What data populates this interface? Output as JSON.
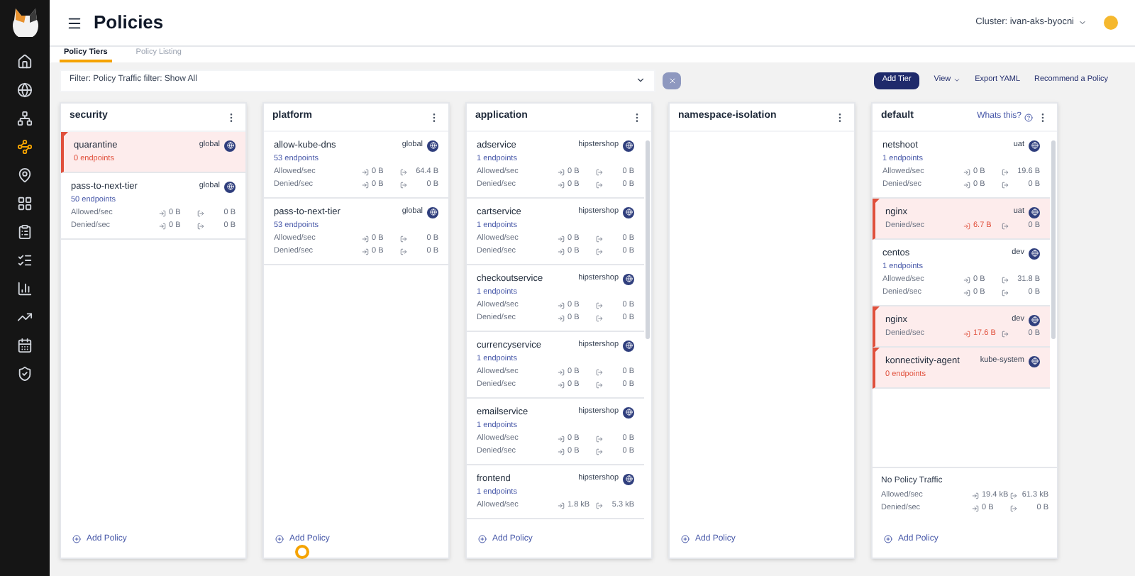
{
  "header": {
    "title": "Policies",
    "cluster": "Cluster: ivan-aks-byocni"
  },
  "sidebar": {
    "items": [
      {
        "selected": false
      },
      {
        "selected": false
      },
      {
        "selected": false
      },
      {
        "selected": true
      },
      {
        "selected": false
      },
      {
        "selected": false
      },
      {
        "selected": false
      },
      {
        "selected": false
      },
      {
        "selected": false
      },
      {
        "selected": false
      },
      {
        "selected": false
      },
      {
        "selected": false
      }
    ]
  },
  "tabs": [
    {
      "label": "Policy Tiers",
      "selected": true
    },
    {
      "label": "Policy Listing",
      "selected": false
    }
  ],
  "filter": {
    "value": "Filter: Policy Traffic filter: Show All"
  },
  "toolbar": [
    {
      "label": "Add Tier",
      "kind": "primary"
    },
    {
      "label": "View",
      "kind": "menu"
    },
    {
      "label": "Export YAML",
      "kind": "link"
    },
    {
      "label": "Recommend a Policy",
      "kind": "link"
    }
  ],
  "tiers": [
    {
      "name": "security",
      "scrollable": false,
      "pointer": false,
      "add_label": "Add Policy",
      "policies": [
        {
          "name": "quarantine",
          "namespace": "global",
          "alert": true,
          "endpoints": "0 endpoints"
        },
        {
          "name": "pass-to-next-tier",
          "namespace": "global",
          "alert": false,
          "endpoints": "50 endpoints",
          "rows": [
            {
              "label": "Allowed/sec",
              "in": "0 B",
              "out": "0 B",
              "alert": false
            },
            {
              "label": "Denied/sec",
              "in": "0 B",
              "out": "0 B",
              "alert": false
            }
          ]
        }
      ]
    },
    {
      "name": "platform",
      "scrollable": false,
      "pointer": true,
      "add_label": "Add Policy",
      "policies": [
        {
          "name": "allow-kube-dns",
          "namespace": "global",
          "alert": false,
          "endpoints": "53 endpoints",
          "rows": [
            {
              "label": "Allowed/sec",
              "in": "0 B",
              "out": "64.4 B",
              "alert": false
            },
            {
              "label": "Denied/sec",
              "in": "0 B",
              "out": "0 B",
              "alert": false
            }
          ]
        },
        {
          "name": "pass-to-next-tier",
          "namespace": "global",
          "alert": false,
          "endpoints": "53 endpoints",
          "rows": [
            {
              "label": "Allowed/sec",
              "in": "0 B",
              "out": "0 B",
              "alert": false
            },
            {
              "label": "Denied/sec",
              "in": "0 B",
              "out": "0 B",
              "alert": false
            }
          ]
        }
      ]
    },
    {
      "name": "application",
      "scrollable": true,
      "pointer": false,
      "add_label": "Add Policy",
      "policies": [
        {
          "name": "adservice",
          "namespace": "hipstershop",
          "alert": false,
          "endpoints": "1 endpoints",
          "rows": [
            {
              "label": "Allowed/sec",
              "in": "0 B",
              "out": "0 B",
              "alert": false
            },
            {
              "label": "Denied/sec",
              "in": "0 B",
              "out": "0 B",
              "alert": false
            }
          ]
        },
        {
          "name": "cartservice",
          "namespace": "hipstershop",
          "alert": false,
          "endpoints": "1 endpoints",
          "rows": [
            {
              "label": "Allowed/sec",
              "in": "0 B",
              "out": "0 B",
              "alert": false
            },
            {
              "label": "Denied/sec",
              "in": "0 B",
              "out": "0 B",
              "alert": false
            }
          ]
        },
        {
          "name": "checkoutservice",
          "namespace": "hipstershop",
          "alert": false,
          "endpoints": "1 endpoints",
          "rows": [
            {
              "label": "Allowed/sec",
              "in": "0 B",
              "out": "0 B",
              "alert": false
            },
            {
              "label": "Denied/sec",
              "in": "0 B",
              "out": "0 B",
              "alert": false
            }
          ]
        },
        {
          "name": "currencyservice",
          "namespace": "hipstershop",
          "alert": false,
          "endpoints": "1 endpoints",
          "rows": [
            {
              "label": "Allowed/sec",
              "in": "0 B",
              "out": "0 B",
              "alert": false
            },
            {
              "label": "Denied/sec",
              "in": "0 B",
              "out": "0 B",
              "alert": false
            }
          ]
        },
        {
          "name": "emailservice",
          "namespace": "hipstershop",
          "alert": false,
          "endpoints": "1 endpoints",
          "rows": [
            {
              "label": "Allowed/sec",
              "in": "0 B",
              "out": "0 B",
              "alert": false
            },
            {
              "label": "Denied/sec",
              "in": "0 B",
              "out": "0 B",
              "alert": false
            }
          ]
        },
        {
          "name": "frontend",
          "namespace": "hipstershop",
          "alert": false,
          "endpoints": "1 endpoints",
          "rows": [
            {
              "label": "Allowed/sec",
              "in": "1.8 kB",
              "out": "5.3 kB",
              "alert": false
            }
          ]
        }
      ]
    },
    {
      "name": "namespace-isolation",
      "scrollable": false,
      "pointer": false,
      "add_label": "Add Policy"
    },
    {
      "name": "default",
      "help": "Whats this?",
      "scrollable": true,
      "pointer": false,
      "add_label": "Add Policy",
      "policies": [
        {
          "name": "netshoot",
          "namespace": "uat",
          "alert": false,
          "endpoints": "1 endpoints",
          "rows": [
            {
              "label": "Allowed/sec",
              "in": "0 B",
              "out": "19.6 B",
              "alert": false
            },
            {
              "label": "Denied/sec",
              "in": "0 B",
              "out": "0 B",
              "alert": false
            }
          ]
        },
        {
          "name": "nginx",
          "namespace": "uat",
          "alert": true,
          "rows": [
            {
              "label": "Denied/sec",
              "in": "6.7 B",
              "out": "0 B",
              "alert": true
            }
          ]
        },
        {
          "name": "centos",
          "namespace": "dev",
          "alert": false,
          "endpoints": "1 endpoints",
          "rows": [
            {
              "label": "Allowed/sec",
              "in": "0 B",
              "out": "31.8 B",
              "alert": false
            },
            {
              "label": "Denied/sec",
              "in": "0 B",
              "out": "0 B",
              "alert": false
            }
          ]
        },
        {
          "name": "nginx",
          "namespace": "dev",
          "alert": true,
          "rows": [
            {
              "label": "Denied/sec",
              "in": "17.6 B",
              "out": "0 B",
              "alert": true
            }
          ]
        },
        {
          "name": "konnectivity-agent",
          "namespace": "kube-system",
          "alert": true,
          "endpoints": "0 endpoints"
        }
      ],
      "unmatched": {
        "title": "No Policy Traffic",
        "rows": [
          {
            "label": "Allowed/sec",
            "in": "19.4 kB",
            "out": "61.3 kB",
            "alert": false
          },
          {
            "label": "Denied/sec",
            "in": "0 B",
            "out": "0 B",
            "alert": false
          }
        ]
      }
    }
  ]
}
